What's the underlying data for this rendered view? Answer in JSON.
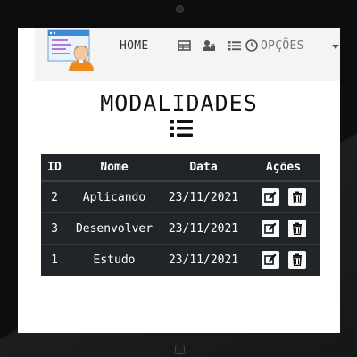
{
  "navbar": {
    "home_label": "HOME",
    "options_label": "OPÇÕES",
    "icons": [
      "table-icon",
      "user-lock-icon",
      "list-icon",
      "clock-icon"
    ]
  },
  "page": {
    "title": "MODALIDADES"
  },
  "table": {
    "headers": {
      "id": "ID",
      "nome": "Nome",
      "data": "Data",
      "acoes": "Ações"
    },
    "rows": [
      {
        "id": "2",
        "nome": "Aplicando",
        "data": "23/11/2021"
      },
      {
        "id": "3",
        "nome": "Desenvolver",
        "data": "23/11/2021"
      },
      {
        "id": "1",
        "nome": "Estudo",
        "data": "23/11/2021"
      }
    ],
    "actions": [
      "edit-icon",
      "trash-icon"
    ]
  },
  "colors": {
    "table_bg": "#212529",
    "navbar_bg": "#f4f4f4",
    "device_frame": "#0d0d0d"
  }
}
